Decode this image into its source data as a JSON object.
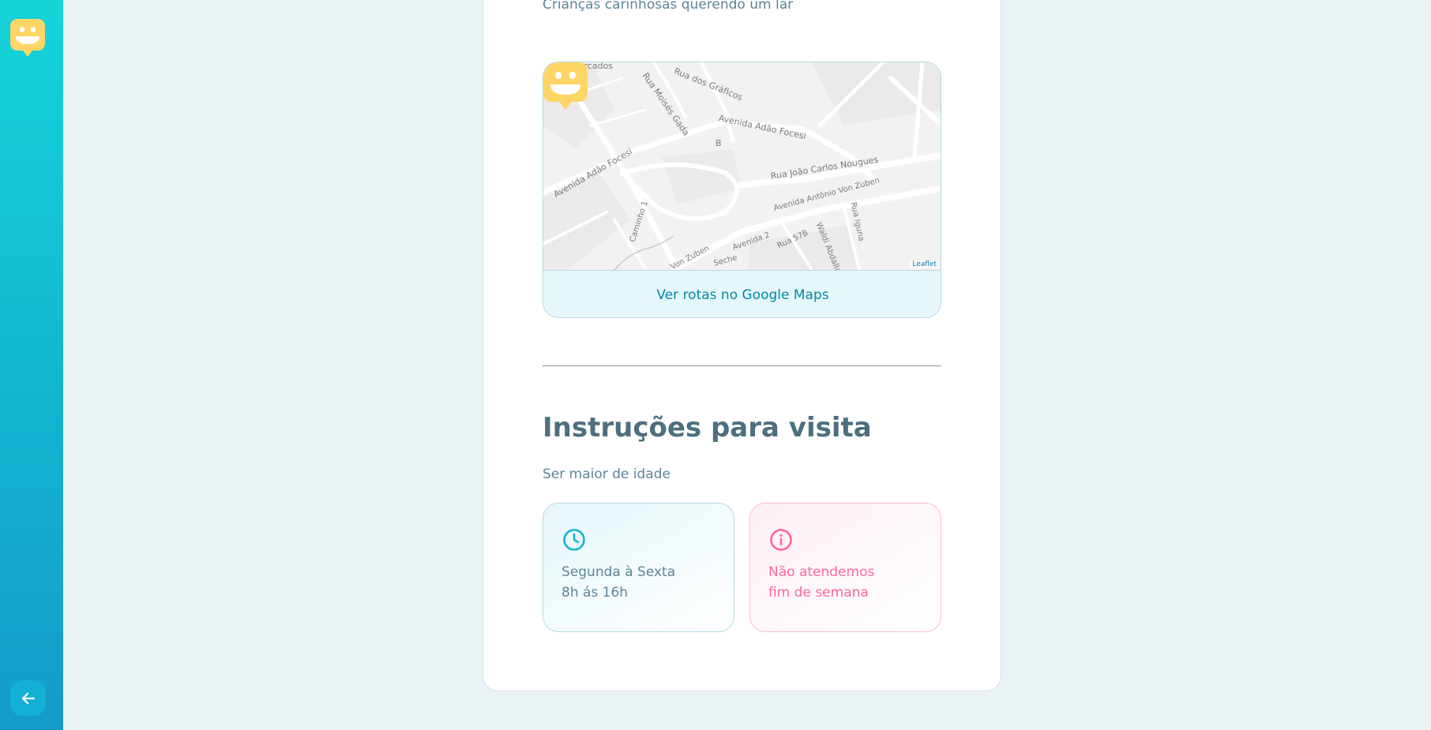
{
  "sidebar": {
    "logo_icon": "smiley-logo-icon",
    "back_icon": "arrow-left-icon",
    "colors": {
      "gradient_top": "#16d4d8",
      "gradient_bottom": "#159bc7",
      "logo": "#ffd666"
    }
  },
  "orphanage": {
    "description": "Crianças carinhosas querendo um lar"
  },
  "map": {
    "streets": [
      "Supermercados",
      "Rua Moisés Gada",
      "Rua dos Gráficos",
      "Avenida Adão Focesi",
      "Avenida Adão Focesi",
      "Rua João Carlos Nougues",
      "Avenida Antônio Von Zuben",
      "Rua Iguna",
      "Caminho 1",
      "Von Zuben",
      "Avenida 2",
      "Rua 57B",
      "Waldi Abdalla C.",
      "Seche",
      "B"
    ],
    "attribution": "Leaflet",
    "directions_link": "Ver rotas no Google Maps",
    "pin_icon": "smiley-map-pin-icon"
  },
  "visit": {
    "title": "Instruções para visita",
    "instructions": "Ser maior de idade",
    "hours": {
      "icon": "clock-icon",
      "line1": "Segunda à Sexta",
      "line2": "8h ás 16h"
    },
    "weekend": {
      "icon": "info-icon",
      "line1": "Não atendemos",
      "line2": "fim de semana"
    }
  }
}
